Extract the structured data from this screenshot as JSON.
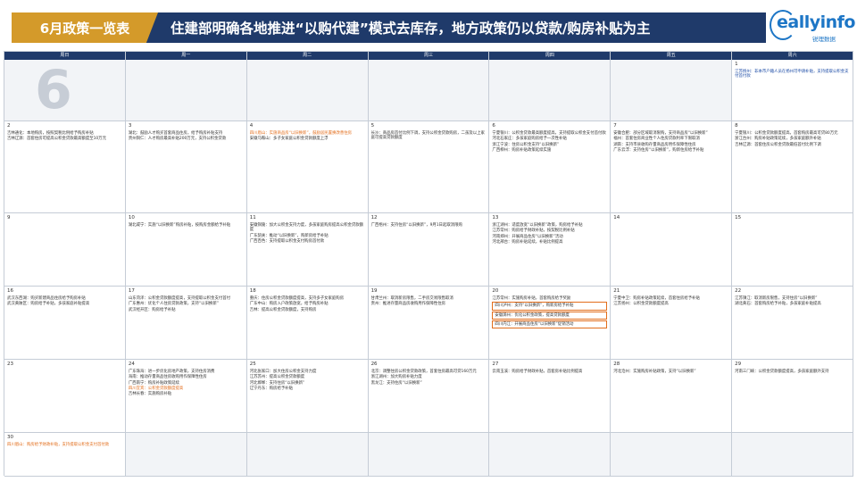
{
  "header": {
    "left_title": "6月政策一览表",
    "main_title": "住建部明确各地推进“以购代建”模式去库存，地方政策仍以贷款/购房补贴为主"
  },
  "logo": {
    "text": "eallyinfo",
    "sub": "锐理数据"
  },
  "calendar": {
    "big_month": "6",
    "weekdays": [
      "周日",
      "周一",
      "周二",
      "周三",
      "周四",
      "周五",
      "周六"
    ],
    "weeks": [
      [
        {
          "day": "",
          "shade": true,
          "notes": []
        },
        {
          "day": "",
          "shade": true,
          "notes": []
        },
        {
          "day": "",
          "shade": true,
          "notes": []
        },
        {
          "day": "",
          "shade": true,
          "notes": []
        },
        {
          "day": "",
          "shade": true,
          "notes": []
        },
        {
          "day": "",
          "shade": true,
          "notes": []
        },
        {
          "day": "1",
          "shade": false,
          "notes": [
            {
              "text": "江苏扬州：非本市户籍人员在扬州可申请补贴，支持提取公积金支付首付款",
              "style": "blue"
            }
          ]
        }
      ],
      [
        {
          "day": "2",
          "notes": [
            {
              "text": "吉林通化：本地购房，按照契税比例给予购房补贴",
              "style": ""
            },
            {
              "text": "吉林辽源：首套住房可提高公积金贷款最高额度至10万元",
              "style": ""
            }
          ]
        },
        {
          "day": "3",
          "notes": [
            {
              "text": "湖北：鼓励人才购买首套商品住房，给予购房补贴支持",
              "style": ""
            },
            {
              "text": "贵州铜仁：人才购房最高补贴200万元，支持公积金贷款",
              "style": ""
            }
          ]
        },
        {
          "day": "4",
          "notes": [
            {
              "text": "四川眉山：实施商品房“以旧换新”，鼓励居民置换改善住房",
              "style": "orange"
            },
            {
              "text": "安徽马鞍山：多子女家庭公积金贷款额度上浮",
              "style": ""
            }
          ]
        },
        {
          "day": "5",
          "notes": [
            {
              "text": "长沙：商品房首付比例下调，支持公积金贷款购房，二孩及以上家庭可提高贷款额度",
              "style": ""
            }
          ]
        },
        {
          "day": "6",
          "notes": [
            {
              "text": "宁夏银川：公积金贷款最高额度提高，支持提取公积金支付首付款",
              "style": ""
            },
            {
              "text": "河北石家庄：多孩家庭购房给予一次性补贴",
              "style": ""
            },
            {
              "text": "浙江宁波：住房公积金支持“以旧换新”",
              "style": ""
            },
            {
              "text": "广西柳州：购房补贴政策延续实施",
              "style": ""
            }
          ]
        },
        {
          "day": "7",
          "notes": [
            {
              "text": "安徽合肥：部分区域取消限购，支持商品房“以旧换新”",
              "style": ""
            },
            {
              "text": "福州：首套住房商业性个人住房贷款利率下限取消",
              "style": ""
            },
            {
              "text": "湖南：支持市县收购存量商品房用作保障性住房",
              "style": ""
            },
            {
              "text": "广东云浮：支持住房“以旧换新”，购新住房给予补贴",
              "style": ""
            }
          ]
        },
        {
          "day": "8",
          "notes": [
            {
              "text": "宁夏银川：公积金贷款额度提高，首套购房最高可贷80万元",
              "style": ""
            },
            {
              "text": "浙江台州：购房补贴政策延续，多孩家庭额外补贴",
              "style": ""
            },
            {
              "text": "吉林辽源：首套住房公积金贷款最低首付比例下调",
              "style": ""
            }
          ]
        }
      ],
      [
        {
          "day": "9",
          "notes": []
        },
        {
          "day": "10",
          "notes": [
            {
              "text": "湖北咸宁：实施“以旧换新”购房补贴，按购房金额给予补贴",
              "style": ""
            }
          ]
        },
        {
          "day": "11",
          "notes": [
            {
              "text": "安徽铜陵：加大公积金支持力度，多孩家庭购房提高公积金贷款额度",
              "style": ""
            },
            {
              "text": "广东韶关：推动“以旧换新”，购新房给予补贴",
              "style": ""
            },
            {
              "text": "广西百色：支持提取公积金支付购房首付款",
              "style": ""
            }
          ]
        },
        {
          "day": "12",
          "notes": [
            {
              "text": "广西梧州：支持住房“以旧换新”，9月1日起取消限购",
              "style": ""
            }
          ]
        },
        {
          "day": "13",
          "notes": [
            {
              "text": "浙江湖州：适度放宽“以旧换新”政策，购房给予补贴",
              "style": ""
            },
            {
              "text": "江苏常州：购房给予财政补贴，按契税比例补贴",
              "style": ""
            },
            {
              "text": "河南郑州：开展商品住房“以旧换新”活动",
              "style": ""
            },
            {
              "text": "河北邢台：购房补贴延续，补贴比例提高",
              "style": ""
            }
          ]
        },
        {
          "day": "14",
          "notes": []
        },
        {
          "day": "15",
          "notes": []
        }
      ],
      [
        {
          "day": "16",
          "notes": [
            {
              "text": "武汉东西湖：购买新建商品住房给予购房补贴",
              "style": ""
            },
            {
              "text": "武汉黄陂区：购房给予补贴，多孩家庭补贴提高",
              "style": ""
            }
          ]
        },
        {
          "day": "17",
          "notes": [
            {
              "text": "山东菏泽：公积金贷款额度提高，支持提取公积金支付首付",
              "style": ""
            },
            {
              "text": "广东惠州：优化个人住房贷款政策，支持“以旧换新”",
              "style": ""
            },
            {
              "text": "武汉经开区：购房给予补贴",
              "style": ""
            }
          ]
        },
        {
          "day": "18",
          "notes": [
            {
              "text": "重庆：住房公积金贷款额度提高，支持多子女家庭购房",
              "style": ""
            },
            {
              "text": "广东中山：购房入户政策放宽，给予购房补贴",
              "style": ""
            },
            {
              "text": "吉林：提高公积金贷款额度，支持购房",
              "style": ""
            }
          ]
        },
        {
          "day": "19",
          "notes": [
            {
              "text": "甘肃兰州：取消新房限售，二手房交易限售取消",
              "style": ""
            },
            {
              "text": "贵州：推进存量商品房收购用作保障性住房",
              "style": ""
            }
          ]
        },
        {
          "day": "20",
          "notes": [
            {
              "text": "江苏常州：实施购房补贴，首套购房给予奖励",
              "style": ""
            },
            {
              "text": "四川泸州：支持“以旧换新”，购新房给予补贴",
              "style": "boxed"
            },
            {
              "text": "安徽滁州：优化公积金政策，提高贷款额度",
              "style": "boxed"
            },
            {
              "text": "四川内江：开展商品住房“以旧换新”促销活动",
              "style": "boxed"
            }
          ]
        },
        {
          "day": "21",
          "notes": [
            {
              "text": "宁夏中卫：购房补贴政策延续，首套住房给予补贴",
              "style": ""
            },
            {
              "text": "江苏扬州：公积金贷款额度提高",
              "style": ""
            }
          ]
        },
        {
          "day": "22",
          "notes": [
            {
              "text": "江苏镇江：取消新房限售，支持住房“以旧换新”",
              "style": ""
            },
            {
              "text": "湖北黄石：首套购房给予补贴，多孩家庭补贴提高",
              "style": ""
            }
          ]
        }
      ],
      [
        {
          "day": "23",
          "notes": []
        },
        {
          "day": "24",
          "notes": [
            {
              "text": "广东珠海：进一步优化房地产政策，支持住房消费",
              "style": ""
            },
            {
              "text": "海南：推动存量商品住房收购用作保障性住房",
              "style": ""
            },
            {
              "text": "广西南宁：购房补贴政策延续",
              "style": ""
            },
            {
              "text": "四川宜宾：公积金贷款额度提高",
              "style": "orange"
            },
            {
              "text": "吉林长春：实施购房补贴",
              "style": ""
            }
          ]
        },
        {
          "day": "25",
          "notes": [
            {
              "text": "河北张家口：加大住房公积金支持力度",
              "style": ""
            },
            {
              "text": "江苏苏州：提高公积金贷款额度",
              "style": ""
            },
            {
              "text": "河北邯郸：支持住房“以旧换新”",
              "style": ""
            },
            {
              "text": "辽宁丹东：购房给予补贴",
              "style": ""
            }
          ]
        },
        {
          "day": "26",
          "notes": [
            {
              "text": "北京：调整住房公积金贷款政策，首套住房最高可贷160万元",
              "style": ""
            },
            {
              "text": "浙江湖州：加大购房补贴力度",
              "style": ""
            },
            {
              "text": "黑龙江：支持住房“以旧换新”",
              "style": ""
            }
          ]
        },
        {
          "day": "27",
          "notes": [
            {
              "text": "云南玉溪：购房给予财政补贴，首套房补贴比例提高",
              "style": ""
            }
          ]
        },
        {
          "day": "28",
          "notes": [
            {
              "text": "河北沧州：实施购房补贴政策，支持“以旧换新”",
              "style": ""
            }
          ]
        },
        {
          "day": "29",
          "notes": [
            {
              "text": "河南三门峡：公积金贷款额度提高，多孩家庭额外支持",
              "style": ""
            }
          ]
        }
      ],
      [
        {
          "day": "30",
          "notes": [
            {
              "text": "四川眉山：购房给予财政补贴，支持提取公积金支付首付款",
              "style": "orange"
            }
          ]
        },
        {
          "day": "",
          "shade": true,
          "notes": []
        },
        {
          "day": "",
          "shade": true,
          "notes": []
        },
        {
          "day": "",
          "shade": true,
          "notes": []
        },
        {
          "day": "",
          "shade": true,
          "notes": []
        },
        {
          "day": "",
          "shade": true,
          "notes": []
        },
        {
          "day": "",
          "shade": true,
          "notes": []
        }
      ]
    ]
  }
}
